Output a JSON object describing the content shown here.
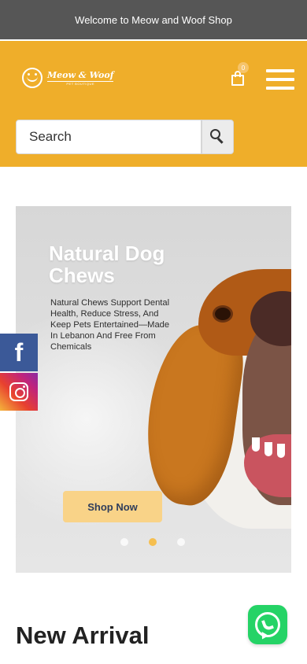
{
  "topbar": {
    "message": "Welcome to Meow and Woof Shop"
  },
  "header": {
    "logo": {
      "name": "Meow & Woof",
      "tagline": "PET BOUTIQUE"
    },
    "cart": {
      "count": "0"
    },
    "menu_icon": "hamburger-menu-icon"
  },
  "search": {
    "placeholder": "Search",
    "value": "",
    "button_icon": "search-icon"
  },
  "hero": {
    "title": "Natural Dog Chews",
    "description": "Natural Chews Support Dental Health, Reduce Stress, And Keep Pets Entertained—Made In Lebanon And Free From Chemicals",
    "cta_label": "Shop Now",
    "slides": {
      "count": 3,
      "active": 2
    }
  },
  "social": [
    {
      "network": "facebook",
      "icon": "facebook-icon",
      "glyph": "f"
    },
    {
      "network": "instagram",
      "icon": "instagram-icon"
    }
  ],
  "sections": {
    "new_arrival_title": "New Arrival"
  },
  "floating": {
    "whatsapp_icon": "whatsapp-icon"
  },
  "colors": {
    "topbar_bg": "#565656",
    "header_bg": "#efae2a",
    "cta_bg": "#f9d388",
    "facebook": "#3b5998",
    "whatsapp": "#25d366"
  }
}
